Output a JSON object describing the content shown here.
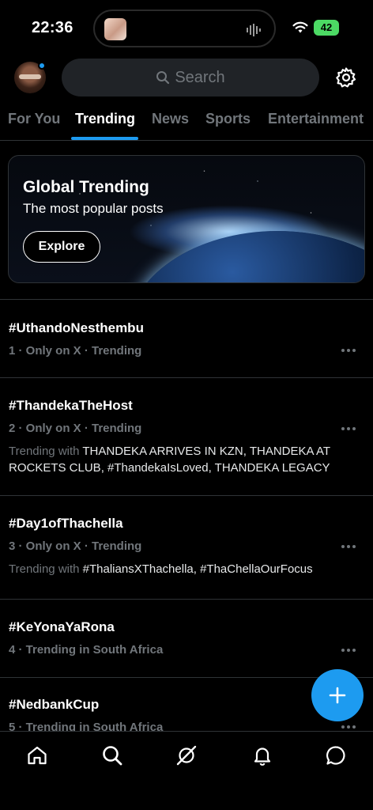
{
  "status_bar": {
    "time": "22:36",
    "battery": "42"
  },
  "search": {
    "placeholder": "Search"
  },
  "tabs": [
    {
      "label": "For You",
      "active": false
    },
    {
      "label": "Trending",
      "active": true
    },
    {
      "label": "News",
      "active": false
    },
    {
      "label": "Sports",
      "active": false
    },
    {
      "label": "Entertainment",
      "active": false
    }
  ],
  "banner": {
    "title": "Global Trending",
    "subtitle": "The most popular posts",
    "button_label": "Explore"
  },
  "trends": [
    {
      "title": "#UthandoNesthembu",
      "meta": "1 · Only on X · Trending"
    },
    {
      "title": "#ThandekaTheHost",
      "meta": "2 · Only on X · Trending",
      "with_prefix": "Trending with ",
      "with_text": "THANDEKA ARRIVES IN KZN, THANDEKA AT ROCKETS CLUB, #ThandekaIsLoved, THANDEKA LEGACY"
    },
    {
      "title": "#Day1ofThachella",
      "meta": "3 · Only on X · Trending",
      "with_prefix": "Trending with ",
      "with_text": "#ThaliansXThachella, #ThaChellaOurFocus"
    },
    {
      "title": "#KeYonaYaRona",
      "meta": "4 · Trending in South Africa"
    },
    {
      "title": "#NedbankCup",
      "meta": "5 · Trending in South Africa"
    }
  ],
  "colors": {
    "accent": "#1d9bf0",
    "background": "#000000",
    "muted": "#71767b"
  },
  "icons": [
    "search-icon",
    "gear-icon",
    "plus-icon",
    "home-icon",
    "grok-icon",
    "bell-icon",
    "chat-icon"
  ]
}
